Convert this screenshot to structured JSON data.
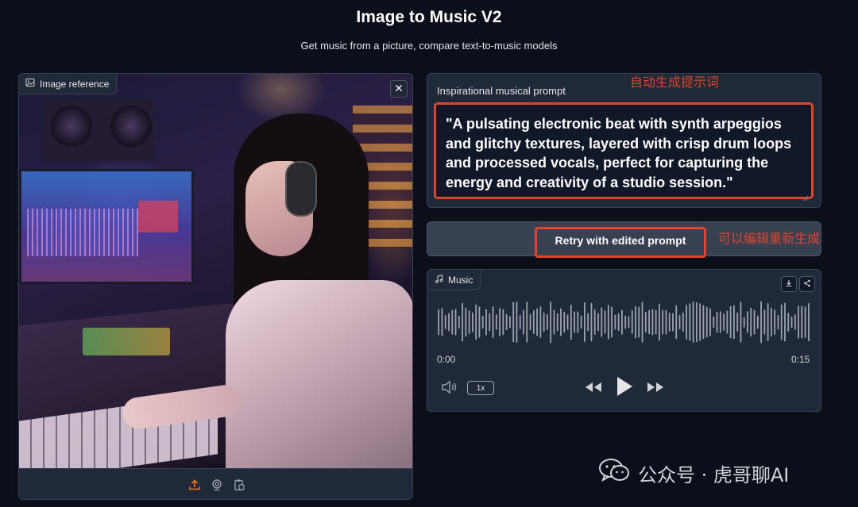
{
  "header": {
    "title": "Image to Music V2",
    "subtitle": "Get music from a picture, compare text-to-music models"
  },
  "image_panel": {
    "label": "Image reference",
    "label_icon": "image-icon",
    "close_icon": "close-icon",
    "toolbar_icons": [
      "upload-icon",
      "webcam-icon",
      "clipboard-paste-icon"
    ]
  },
  "prompt_panel": {
    "label": "Inspirational musical prompt",
    "value": "\"A pulsating electronic beat with synth arpeggios and glitchy textures, layered with crisp drum loops and processed vocals, perfect for capturing the energy and creativity of a studio session.\""
  },
  "annotations": {
    "prompt_note": "自动生成提示词",
    "retry_note": "可以编辑重新生成"
  },
  "retry_button": {
    "label": "Retry with edited prompt"
  },
  "music_panel": {
    "label": "Music",
    "label_icon": "music-note-icon",
    "current_time": "0:00",
    "duration": "0:15",
    "playback_speed": "1x",
    "playback_progress": 0,
    "icons": [
      "download-icon",
      "share-icon",
      "volume-icon",
      "rewind-icon",
      "play-icon",
      "fast-forward-icon"
    ]
  },
  "watermark": {
    "text": "公众号 · 虎哥聊AI",
    "icon": "wechat-icon"
  },
  "colors": {
    "background": "#0b0f19",
    "panel": "#1f2937",
    "highlight": "#e0452c",
    "upload_icon": "#f97316"
  }
}
